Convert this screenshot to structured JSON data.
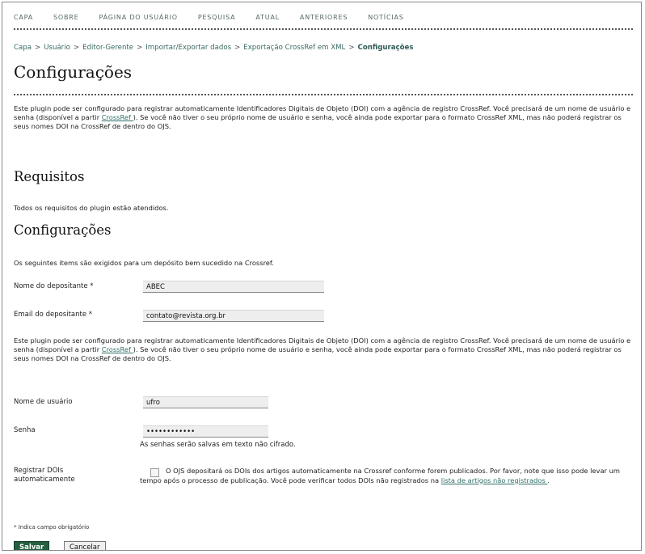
{
  "nav": [
    "CAPA",
    "SOBRE",
    "PÁGINA DO USUÁRIO",
    "PESQUISA",
    "ATUAL",
    "ANTERIORES",
    "NOTÍCIAS"
  ],
  "breadcrumb": [
    "Capa",
    "Usuário",
    "Editor-Gerente",
    "Importar/Exportar dados",
    "Exportação CrossRef em XML",
    "Configurações"
  ],
  "page_title": "Configurações",
  "intro": {
    "before": "Este plugin pode ser configurado para registrar automaticamente Identificadores Digitais de Objeto (DOI) com a agência de registro CrossRef. Você precisará de um nome de usuário e senha (disponível a partir ",
    "link": "CrossRef ",
    "after": "). Se você não tiver o seu próprio nome de usuário e senha, você ainda pode exportar para o formato CrossRef XML, mas não poderá registrar os seus nomes DOI na CrossRef de dentro do OJS."
  },
  "requirements": {
    "heading": "Requisitos",
    "text": "Todos os requisitos do plugin estão atendidos."
  },
  "settings": {
    "heading": "Configurações",
    "text": "Os seguintes items são exigidos para um depósito bem sucedido na Crossref."
  },
  "depositor_name": {
    "label": "Nome do depositante *",
    "value": "ABEC"
  },
  "depositor_email": {
    "label": "Email do depositante *",
    "value": "contato@revista.org.br"
  },
  "username": {
    "label": "Nome de usuário",
    "value": "ufro"
  },
  "password": {
    "label": "Senha",
    "value": "••••••••••••",
    "hint": "As senhas serão salvas em texto não cifrado."
  },
  "auto_register": {
    "label_line1": "Registrar DOIs",
    "label_line2": "automaticamente",
    "text": "O OJS depositará os DOIs dos artigos automaticamente na Crossref conforme forem publicados. Por favor, note que isso pode levar um tempo após o processo de publicação. Você pode verificar todos DOIs não registrados na ",
    "link": "lista de artigos não registrados ",
    "after": "."
  },
  "required_note": "* Indica campo obrigatório",
  "buttons": {
    "save": "Salvar",
    "cancel": "Cancelar"
  }
}
